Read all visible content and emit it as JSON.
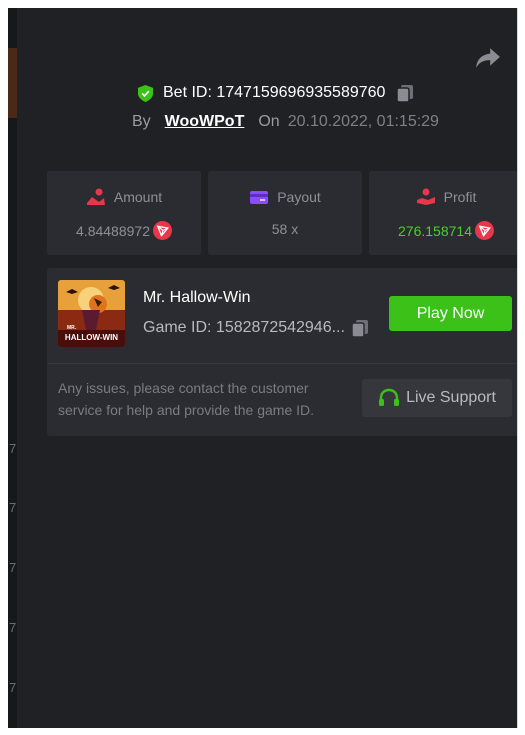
{
  "header": {
    "bet_id_label": "Bet ID:",
    "bet_id": "1747159696935589760",
    "by_label": "By",
    "username": "WooWPoT",
    "on_label": "On",
    "datetime": "20.10.2022, 01:15:29"
  },
  "stats": [
    {
      "label": "Amount",
      "value": "4.84488972",
      "icon": "amount-icon"
    },
    {
      "label": "Payout",
      "value": "58 x",
      "icon": "payout-icon"
    },
    {
      "label": "Profit",
      "value": "276.158714",
      "icon": "profit-icon"
    }
  ],
  "game": {
    "title": "Mr. Hallow-Win",
    "game_id_label": "Game ID:",
    "game_id": "1582872542946...",
    "thumb_text_small": "MR.",
    "thumb_text_large": "HALLOW-WIN",
    "play_label": "Play Now",
    "note": "Any issues, please contact the customer service for help and provide the game ID.",
    "support_label": "Live Support"
  },
  "background_peek": [
    "7",
    "7",
    "7",
    "7",
    "7"
  ],
  "colors": {
    "panel": "#202125",
    "card": "#2a2c31",
    "accent_green": "#3bc117",
    "profit_green": "#4ccf2a",
    "coin_red": "#e8364b"
  }
}
